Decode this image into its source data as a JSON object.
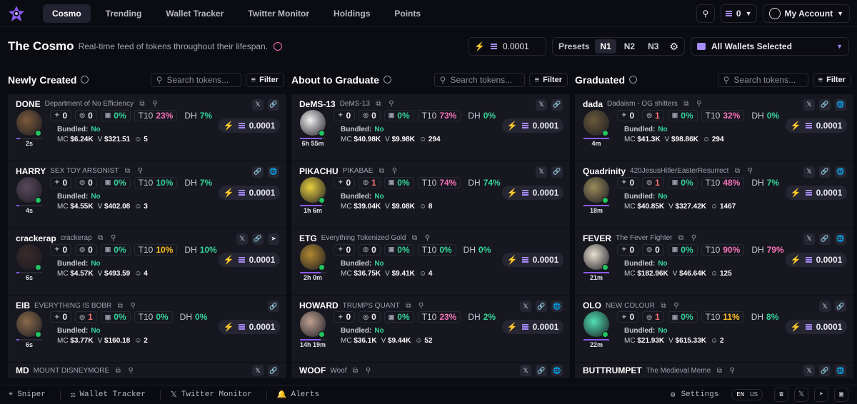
{
  "nav": {
    "tabs": [
      "Cosmo",
      "Trending",
      "Wallet Tracker",
      "Twitter Monitor",
      "Holdings",
      "Points"
    ],
    "wallet_count": "0",
    "account": "My Account"
  },
  "header": {
    "title": "The Cosmo",
    "subtitle": "Real-time feed of tokens throughout their lifespan.",
    "amount": "0.0001",
    "presets_label": "Presets",
    "presets": [
      "N1",
      "N2",
      "N3"
    ],
    "wallets": "All Wallets Selected"
  },
  "search_placeholder": "Search tokens...",
  "filter_label": "Filter",
  "columns": [
    {
      "title": "Newly Created",
      "cards": [
        {
          "ticker": "DONE",
          "name": "Department of No Efficiency",
          "stats": [
            "0",
            "0",
            "0%"
          ],
          "t10": "23%",
          "t10c": "pink",
          "dh": "7%",
          "dhc": "green",
          "bundled": "No",
          "mc": "$6.24K",
          "v": "$321.51",
          "holders": "5",
          "age": "2s",
          "buy": "0.0001",
          "links": [
            "x",
            "link"
          ],
          "av": "#7a5a3a",
          "bar": 0.15
        },
        {
          "ticker": "HARRY",
          "name": "SEX TOY ARSONIST",
          "stats": [
            "0",
            "0",
            "0%"
          ],
          "t10": "10%",
          "t10c": "green",
          "dh": "7%",
          "dhc": "green",
          "bundled": "No",
          "mc": "$4.55K",
          "v": "$402.08",
          "holders": "3",
          "age": "4s",
          "buy": "0.0001",
          "links": [
            "link",
            "web"
          ],
          "av": "#5a4a5a",
          "bar": 0.1
        },
        {
          "ticker": "crackerap",
          "name": "crackerap",
          "stats": [
            "0",
            "0",
            "0%"
          ],
          "t10": "10%",
          "t10c": "yel",
          "dh": "10%",
          "dhc": "green",
          "bundled": "No",
          "mc": "$4.57K",
          "v": "$493.59",
          "holders": "4",
          "age": "6s",
          "buy": "0.0001",
          "links": [
            "x",
            "link",
            "tg"
          ],
          "av": "#3a2a2a",
          "bar": 0.1
        },
        {
          "ticker": "EIB",
          "name": "EVERYTHING IS BOBR",
          "stats": [
            "0",
            "1",
            "0%"
          ],
          "t10": "0%",
          "t10c": "green",
          "dh": "0%",
          "dhc": "green",
          "bundled": "No",
          "mc": "$3.77K",
          "v": "$160.18",
          "holders": "2",
          "age": "6s",
          "buy": "0.0001",
          "links": [
            "link"
          ],
          "av": "#8a6a4a",
          "bar": 0.1,
          "s1red": true
        },
        {
          "ticker": "MD",
          "name": "MOUNT DISNEYMORE",
          "links": [
            "x",
            "link"
          ]
        }
      ]
    },
    {
      "title": "About to Graduate",
      "cards": [
        {
          "ticker": "DeMS-13",
          "name": "DeMS-13",
          "stats": [
            "0",
            "0",
            "0%"
          ],
          "t10": "73%",
          "t10c": "pink",
          "dh": "0%",
          "dhc": "green",
          "bundled": "No",
          "mc": "$40.98K",
          "v": "$9.98K",
          "holders": "294",
          "age": "6h 55m",
          "buy": "0.0001",
          "links": [
            "x",
            "link"
          ],
          "av": "#f0f0f0",
          "bar": 0.85
        },
        {
          "ticker": "PIKACHU",
          "name": "PIKABAE",
          "stats": [
            "0",
            "1",
            "0%"
          ],
          "t10": "74%",
          "t10c": "pink",
          "dh": "74%",
          "dhc": "green",
          "bundled": "No",
          "mc": "$39.04K",
          "v": "$9.08K",
          "holders": "8",
          "age": "1h 6m",
          "buy": "0.0001",
          "links": [
            "x",
            "link"
          ],
          "av": "#e8d040",
          "bar": 0.85,
          "s1red": true
        },
        {
          "ticker": "ETG",
          "name": "Everything Tokenized Gold",
          "stats": [
            "0",
            "0",
            "0%"
          ],
          "t10": "0%",
          "t10c": "green",
          "dh": "0%",
          "dhc": "green",
          "bundled": "No",
          "mc": "$36.75K",
          "v": "$9.41K",
          "holders": "4",
          "age": "2h 0m",
          "buy": "0.0001",
          "links": [],
          "av": "#b08830",
          "bar": 0.8
        },
        {
          "ticker": "HOWARD",
          "name": "TRUMPS QUANT",
          "stats": [
            "0",
            "0",
            "0%"
          ],
          "t10": "23%",
          "t10c": "pink",
          "dh": "2%",
          "dhc": "green",
          "bundled": "No",
          "mc": "$36.1K",
          "v": "$9.44K",
          "holders": "52",
          "age": "14h 19m",
          "buy": "0.0001",
          "links": [
            "x",
            "link",
            "web"
          ],
          "av": "#c0a090",
          "bar": 0.8
        },
        {
          "ticker": "WOOF",
          "name": "Woof",
          "links": [
            "x",
            "link",
            "web"
          ]
        }
      ]
    },
    {
      "title": "Graduated",
      "cards": [
        {
          "ticker": "dada",
          "name": "Dadaism - OG shitters",
          "stats": [
            "0",
            "1",
            "0%"
          ],
          "t10": "32%",
          "t10c": "pink",
          "dh": "0%",
          "dhc": "green",
          "bundled": "No",
          "mc": "$41.3K",
          "v": "$98.86K",
          "holders": "294",
          "age": "4m",
          "buy": "0.0001",
          "links": [
            "x",
            "link",
            "web"
          ],
          "av": "#6a5a3a",
          "bar": 1,
          "s1red": true
        },
        {
          "ticker": "Quadrinity",
          "name": "420JesusHitlerEasterResurrect",
          "stats": [
            "0",
            "1",
            "0%"
          ],
          "t10": "48%",
          "t10c": "pink",
          "dh": "7%",
          "dhc": "green",
          "bundled": "No",
          "mc": "$40.85K",
          "v": "$327.42K",
          "holders": "1467",
          "age": "18m",
          "buy": "0.0001",
          "links": [
            "x",
            "link",
            "web"
          ],
          "av": "#9a8a5a",
          "bar": 1,
          "s1red": true
        },
        {
          "ticker": "FEVER",
          "name": "The Fever Fighter",
          "stats": [
            "0",
            "0",
            "0%"
          ],
          "t10": "90%",
          "t10c": "pink",
          "dh": "79%",
          "dhc": "pink",
          "bundled": "No",
          "mc": "$182.96K",
          "v": "$46.64K",
          "holders": "125",
          "age": "21m",
          "buy": "0.0001",
          "links": [
            "x",
            "link",
            "web"
          ],
          "av": "#e8e0d0",
          "bar": 1
        },
        {
          "ticker": "OLO",
          "name": "NEW COLOUR",
          "stats": [
            "0",
            "1",
            "0%"
          ],
          "t10": "11%",
          "t10c": "yel",
          "dh": "8%",
          "dhc": "green",
          "bundled": "No",
          "mc": "$21.93K",
          "v": "$615.33K",
          "holders": "2",
          "age": "22m",
          "buy": "0.0001",
          "links": [
            "x",
            "link"
          ],
          "av": "#50e0b0",
          "bar": 1,
          "s1red": true
        },
        {
          "ticker": "BUTTRUMPET",
          "name": "The Medieval Meme",
          "links": [
            "x",
            "link",
            "web"
          ]
        }
      ]
    }
  ],
  "footer": {
    "items": [
      "Sniper",
      "Wallet Tracker",
      "Twitter Monitor",
      "Alerts"
    ],
    "settings": "Settings",
    "lang": [
      "EN",
      "US"
    ]
  },
  "labels": {
    "bundled": "Bundled:",
    "mc": "MC",
    "v": "V",
    "t10": "T10",
    "dh": "DH"
  }
}
